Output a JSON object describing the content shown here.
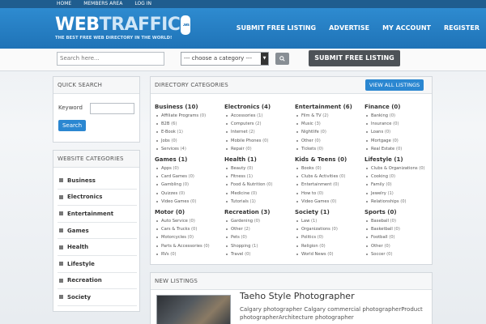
{
  "topbar": {
    "links": [
      "HOME",
      "MEMBERS AREA",
      "LOG IN"
    ]
  },
  "logo": {
    "web": "WEB",
    "traffic": "TRAFFIC",
    "badge": ".ws",
    "tagline": "THE BEST FREE WEB DIRECTORY IN THE WORLD!"
  },
  "nav": {
    "items": [
      "SUBMIT FREE LISTING",
      "ADVERTISE",
      "MY ACCOUNT",
      "REGISTER"
    ]
  },
  "searchbar": {
    "placeholder": "Search here...",
    "category_selected": "--- choose a category ---",
    "search_icon": "magnifier-icon",
    "submit_label": "SUBMIT FREE LISTING"
  },
  "quick_search": {
    "title": "QUICK SEARCH",
    "keyword_label": "Keyword",
    "button_label": "Search"
  },
  "website_categories": {
    "title": "WEBSITE CATEGORIES",
    "items": [
      "Business",
      "Electronics",
      "Entertainment",
      "Games",
      "Health",
      "Lifestyle",
      "Recreation",
      "Society"
    ]
  },
  "directory": {
    "title": "DIRECTORY CATEGORIES",
    "view_all": "VIEW ALL LISTINGS",
    "categories": [
      {
        "title": "Business (10)",
        "subs": [
          [
            "Affiliate Programs",
            "(0)"
          ],
          [
            "B2B",
            "(6)"
          ],
          [
            "E-Book",
            "(1)"
          ],
          [
            "Jobs",
            "(0)"
          ],
          [
            "Services",
            "(4)"
          ]
        ]
      },
      {
        "title": "Electronics (4)",
        "subs": [
          [
            "Accessories",
            "(1)"
          ],
          [
            "Computers",
            "(2)"
          ],
          [
            "Internet",
            "(2)"
          ],
          [
            "Mobile Phones",
            "(0)"
          ],
          [
            "Repair",
            "(0)"
          ]
        ]
      },
      {
        "title": "Entertainment (6)",
        "subs": [
          [
            "Film & TV",
            "(2)"
          ],
          [
            "Music",
            "(3)"
          ],
          [
            "Nightlife",
            "(0)"
          ],
          [
            "Other",
            "(0)"
          ],
          [
            "Tickets",
            "(0)"
          ]
        ]
      },
      {
        "title": "Finance (0)",
        "subs": [
          [
            "Banking",
            "(0)"
          ],
          [
            "Insurance",
            "(0)"
          ],
          [
            "Loans",
            "(0)"
          ],
          [
            "Mortgage",
            "(0)"
          ],
          [
            "Real Estate",
            "(0)"
          ]
        ]
      },
      {
        "title": "Games (1)",
        "subs": [
          [
            "Apps",
            "(0)"
          ],
          [
            "Card Games",
            "(0)"
          ],
          [
            "Gambling",
            "(0)"
          ],
          [
            "Quizzes",
            "(0)"
          ],
          [
            "Video Games",
            "(0)"
          ]
        ]
      },
      {
        "title": "Health (1)",
        "subs": [
          [
            "Beauty",
            "(0)"
          ],
          [
            "Fitness",
            "(1)"
          ],
          [
            "Food & Nutrition",
            "(0)"
          ],
          [
            "Medicine",
            "(0)"
          ],
          [
            "Tutorials",
            "(1)"
          ]
        ]
      },
      {
        "title": "Kids & Teens (0)",
        "subs": [
          [
            "Books",
            "(0)"
          ],
          [
            "Clubs & Activities",
            "(0)"
          ],
          [
            "Entertainment",
            "(0)"
          ],
          [
            "How to",
            "(0)"
          ],
          [
            "Video Games",
            "(0)"
          ]
        ]
      },
      {
        "title": "Lifestyle (1)",
        "subs": [
          [
            "Clubs & Organizations",
            "(0)"
          ],
          [
            "Cooking",
            "(0)"
          ],
          [
            "Family",
            "(0)"
          ],
          [
            "Jewelry",
            "(1)"
          ],
          [
            "Relationships",
            "(0)"
          ]
        ]
      },
      {
        "title": "Motor (0)",
        "subs": [
          [
            "Auto Service",
            "(0)"
          ],
          [
            "Cars & Trucks",
            "(0)"
          ],
          [
            "Motorcycles",
            "(0)"
          ],
          [
            "Parts & Accessories",
            "(0)"
          ],
          [
            "RVs",
            "(0)"
          ]
        ]
      },
      {
        "title": "Recreation (3)",
        "subs": [
          [
            "Gardening",
            "(0)"
          ],
          [
            "Other",
            "(2)"
          ],
          [
            "Pets",
            "(0)"
          ],
          [
            "Shopping",
            "(1)"
          ],
          [
            "Travel",
            "(0)"
          ]
        ]
      },
      {
        "title": "Society (1)",
        "subs": [
          [
            "Law",
            "(1)"
          ],
          [
            "Organizations",
            "(0)"
          ],
          [
            "Politics",
            "(0)"
          ],
          [
            "Religion",
            "(0)"
          ],
          [
            "World News",
            "(0)"
          ]
        ]
      },
      {
        "title": "Sports (0)",
        "subs": [
          [
            "Baseball",
            "(0)"
          ],
          [
            "Basketball",
            "(0)"
          ],
          [
            "Football",
            "(0)"
          ],
          [
            "Other",
            "(0)"
          ],
          [
            "Soccer",
            "(0)"
          ]
        ]
      }
    ]
  },
  "new_listings": {
    "title": "NEW LISTINGS",
    "item": {
      "title": "Taeho Style Photographer",
      "description": "Calgary photographer Calgary commercial photographerProduct photographerArchitecture photographer"
    }
  }
}
